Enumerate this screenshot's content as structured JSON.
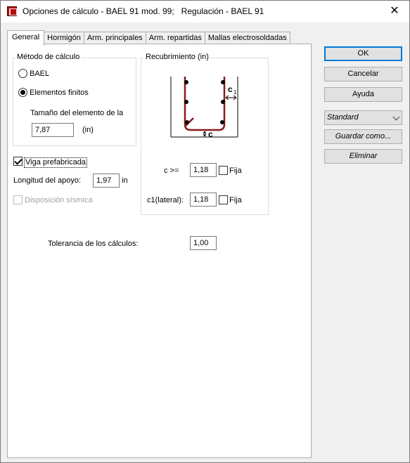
{
  "window": {
    "title": "Opciones de cálculo - BAEL 91 mod. 99;   Regulación - BAEL 91",
    "close_glyph": "✕"
  },
  "tabs": [
    {
      "label": "General"
    },
    {
      "label": "Hormigón"
    },
    {
      "label": "Arm. principales"
    },
    {
      "label": "Arm. repartidas"
    },
    {
      "label": "Mallas electrosoldadas"
    }
  ],
  "calc_method": {
    "title": "Método de cálculo",
    "option_bael": "BAEL",
    "option_fe": "Elementos finitos",
    "selected": "Elementos finitos",
    "element_size_label": "Tamaño del elemento de la",
    "element_size_value": "7,87",
    "element_size_unit": "(in)"
  },
  "prefab": {
    "beam_label": "Viga prefabricada",
    "beam_checked": true,
    "support_length_label": "Longitud del apoyo:",
    "support_length_value": "1,97",
    "support_length_unit": "in",
    "seismic_label": "Disposición sísmica",
    "seismic_checked": false,
    "seismic_enabled": false
  },
  "cover": {
    "title": "Recubrimiento (in)",
    "diagram_labels": {
      "c1": "c",
      "c1_sub": "1",
      "c": "c"
    },
    "c_label": "c >=",
    "c_value": "1,18",
    "c_fixed_label": "Fija",
    "c_fixed_checked": false,
    "c1_label": "c1(lateral):",
    "c1_value": "1,18",
    "c1_fixed_label": "Fija",
    "c1_fixed_checked": false
  },
  "tolerance": {
    "label": "Tolerancia de los cálculos:",
    "value": "1,00"
  },
  "buttons": {
    "ok": "OK",
    "cancel": "Cancelar",
    "help": "Ayuda",
    "save_as": "Guardar como...",
    "delete": "Eliminar"
  },
  "preset": {
    "selected": "Standard"
  },
  "colors": {
    "accent": "#0078d7",
    "rebar": "#8b1a1a"
  }
}
